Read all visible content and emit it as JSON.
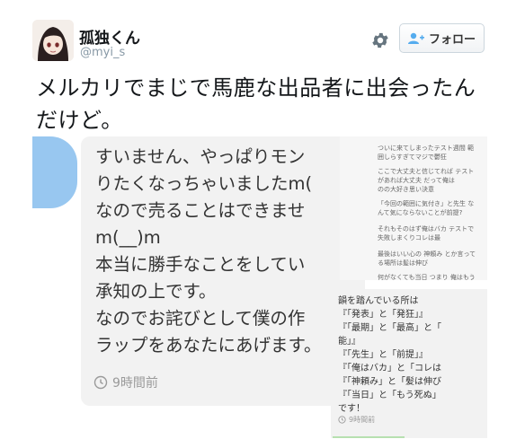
{
  "user": {
    "display_name": "孤独くん",
    "handle": "@myi_s",
    "follow_label": "フォロー"
  },
  "tweet": {
    "text": "メルカリでまじで馬鹿な出品者に出会ったんだけど。"
  },
  "chat": {
    "lines": [
      "すいません、やっぱりモン",
      "りたくなっちゃいましたm(",
      "なので売ることはできませ",
      "m(__)m",
      "本当に勝手なことをしてい",
      "承知の上です。",
      "なのでお詫びとして僕の作",
      "ラップをあなたにあげます。"
    ],
    "time": "9時間前"
  },
  "memo": {
    "top_groups": [
      [
        "ついに来てしまったテスト週間 範",
        "囲しらすぎてマジで鬱狂"
      ],
      [
        "ここで大丈夫と信じてれば テスト",
        "があれば大丈夫 だって俺は",
        "のの大好き思い決意"
      ],
      [
        "「今回の範囲に気付き」と先生 な",
        "んて気にならないことが前提?"
      ],
      [
        "それもそのはず俺はバカ テストで",
        "失敗しまくりコレは最"
      ],
      [
        "最後はいい心の 神頼み とか言って",
        "る場所は髪は伸び"
      ],
      [
        "何がなくても当日 つまり 俺はもう"
      ]
    ],
    "bottom_lines": [
      "韻を踏んでいる所は",
      "『「発表」と「発狂」』",
      "『「最期」と「最高」と「",
      "能」』",
      "『「先生」と「前提」』",
      "『「俺はバカ」と「コレは",
      "『「神頼み」と「髪は伸び",
      "『「当日」と「もう死ぬ」",
      "です！"
    ],
    "time": "9時間前"
  },
  "icons": {
    "gear": "gear-icon",
    "follow": "add-user-icon",
    "clock": "clock-icon"
  },
  "colors": {
    "accent_blue": "#98c7f0",
    "bubble_bg": "#f2f2f2",
    "muted_text": "#8899a6"
  }
}
